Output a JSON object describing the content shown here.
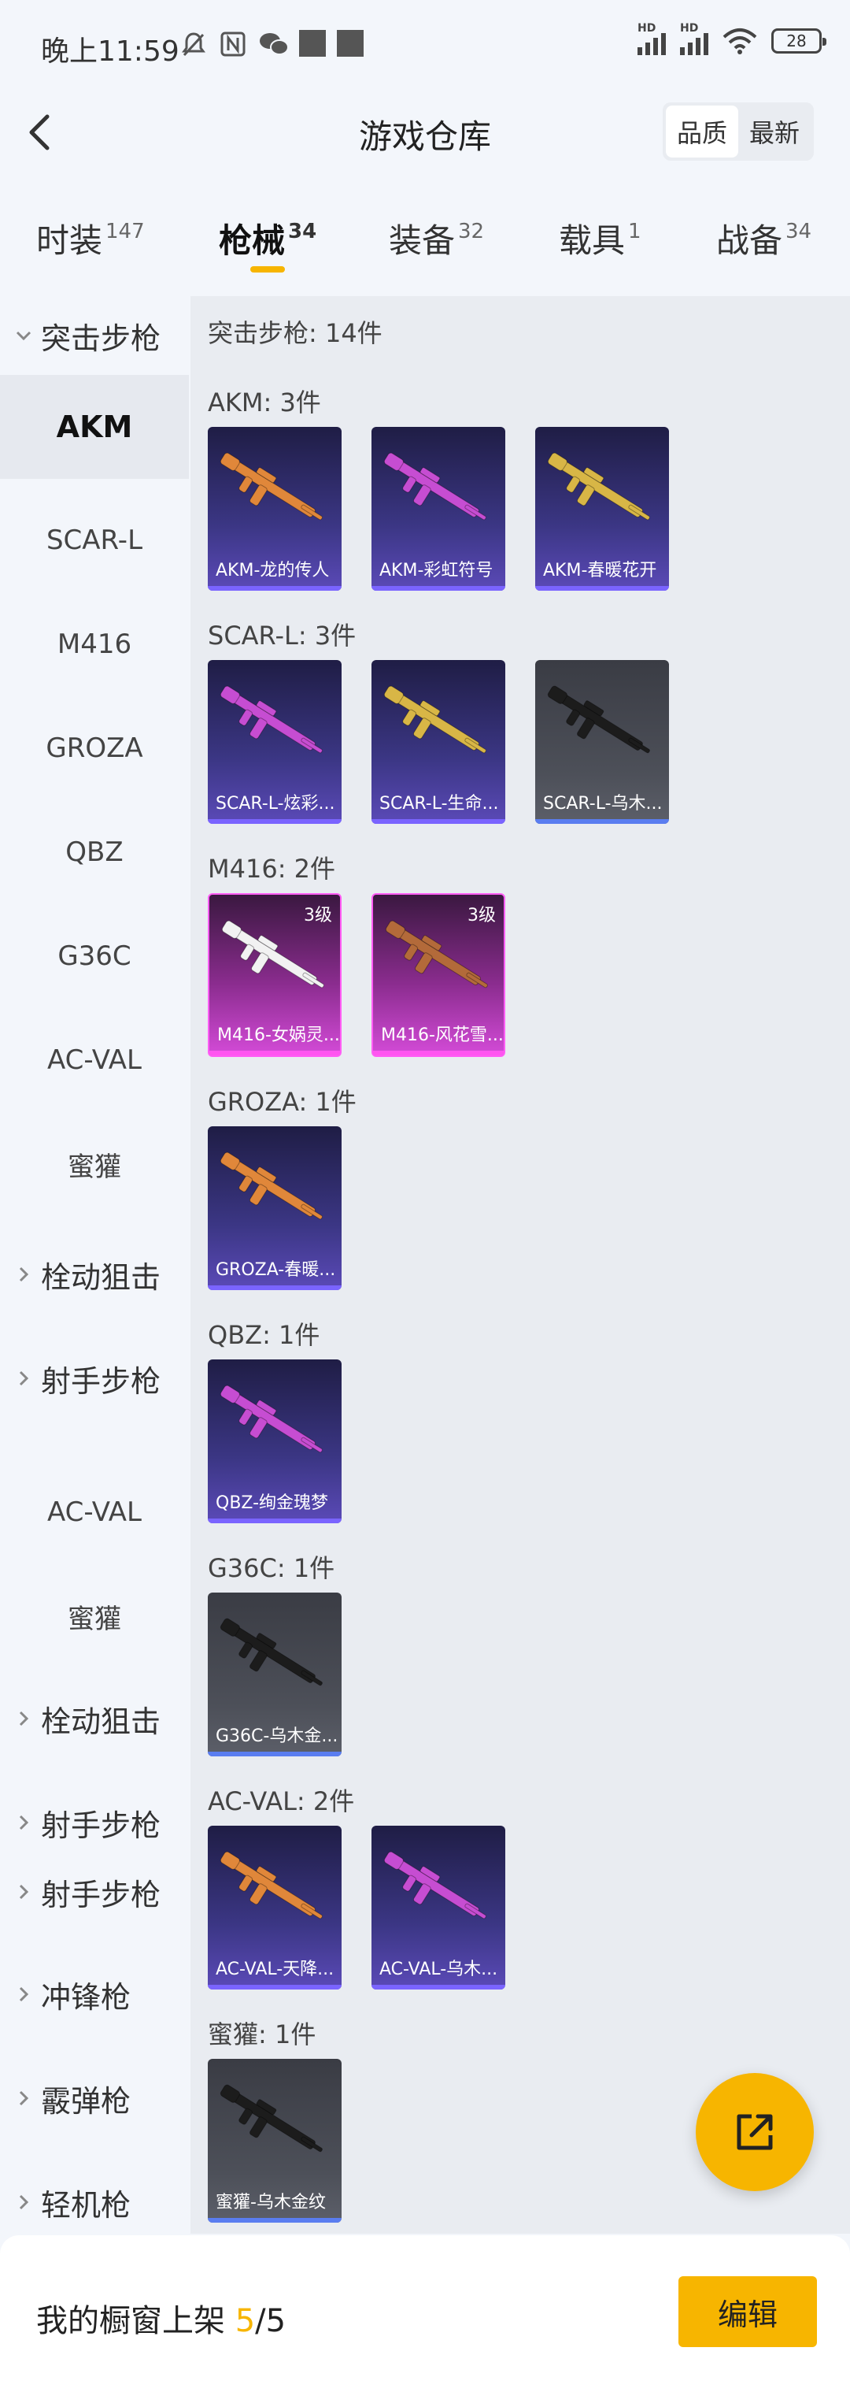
{
  "status": {
    "time": "晚上11:59",
    "battery": "28",
    "icons": [
      "mute-bell-icon",
      "nfc-icon",
      "wechat-icon",
      "notification-square-icon",
      "notification-square-icon",
      "signal-hd-icon",
      "signal-hd-icon",
      "wifi-icon",
      "battery-icon"
    ]
  },
  "header": {
    "title": "游戏仓库",
    "sort_options": [
      "品质",
      "最新"
    ],
    "selected_sort": "品质"
  },
  "tabs": [
    {
      "label": "时装",
      "count": "147"
    },
    {
      "label": "枪械",
      "count": "34"
    },
    {
      "label": "装备",
      "count": "32"
    },
    {
      "label": "载具",
      "count": "1"
    },
    {
      "label": "战备",
      "count": "34"
    }
  ],
  "sidebar": [
    {
      "label": "突击步枪",
      "group": true
    },
    {
      "label": "AKM",
      "active": true
    },
    {
      "label": "SCAR-L"
    },
    {
      "label": "M416"
    },
    {
      "label": "GROZA"
    },
    {
      "label": "QBZ"
    },
    {
      "label": "G36C"
    },
    {
      "label": "AC-VAL"
    },
    {
      "label": "蜜獾"
    },
    {
      "label": "栓动狙击",
      "group": true
    },
    {
      "label": "射手步枪",
      "group": true
    },
    {
      "label": "AC-VAL"
    },
    {
      "label": "蜜獾"
    },
    {
      "label": "栓动狙击",
      "group": true
    },
    {
      "label": "射手步枪",
      "group": true
    },
    {
      "label": "射手步枪",
      "group": true
    },
    {
      "label": "冲锋枪",
      "group": true
    },
    {
      "label": "霰弹枪",
      "group": true
    },
    {
      "label": "轻机枪",
      "group": true
    }
  ],
  "content": {
    "summary": "突击步枪: 14件",
    "sections": [
      {
        "title": "AKM: 3件",
        "items": [
          {
            "name": "AKM-龙的传人",
            "style": "purple"
          },
          {
            "name": "AKM-彩虹符号",
            "style": "purple"
          },
          {
            "name": "AKM-春暖花开",
            "style": "purple"
          }
        ]
      },
      {
        "title": "SCAR-L: 3件",
        "items": [
          {
            "name": "SCAR-L-炫彩...",
            "style": "purple"
          },
          {
            "name": "SCAR-L-生命...",
            "style": "purple"
          },
          {
            "name": "SCAR-L-乌木...",
            "style": "grey"
          }
        ]
      },
      {
        "title": "M416: 2件",
        "items": [
          {
            "name": "M416-女娲灵...",
            "style": "pink",
            "level": "3级"
          },
          {
            "name": "M416-风花雪...",
            "style": "pink",
            "level": "3级"
          }
        ]
      },
      {
        "title": "GROZA: 1件",
        "items": [
          {
            "name": "GROZA-春暖...",
            "style": "purple"
          }
        ]
      },
      {
        "title": "QBZ: 1件",
        "items": [
          {
            "name": "QBZ-绚金瑰梦",
            "style": "purple"
          }
        ]
      },
      {
        "title": "G36C: 1件",
        "items": [
          {
            "name": "G36C-乌木金...",
            "style": "grey"
          }
        ]
      },
      {
        "title": "AC-VAL: 2件",
        "items": [
          {
            "name": "AC-VAL-天降...",
            "style": "purple"
          },
          {
            "name": "AC-VAL-乌木...",
            "style": "purple"
          }
        ]
      },
      {
        "title": "蜜獾: 1件",
        "items": [
          {
            "name": "蜜獾-乌木金纹",
            "style": "grey"
          }
        ]
      }
    ]
  },
  "bottom": {
    "label": "我的橱窗上架",
    "current": "5",
    "total": "/5",
    "edit_label": "编辑"
  },
  "colors": {
    "accent": "#f7b500",
    "card_purple": "#3b3684",
    "card_grey": "#4d5059",
    "card_pink": "#d44bd8"
  },
  "fab_icon": "share-external-icon"
}
